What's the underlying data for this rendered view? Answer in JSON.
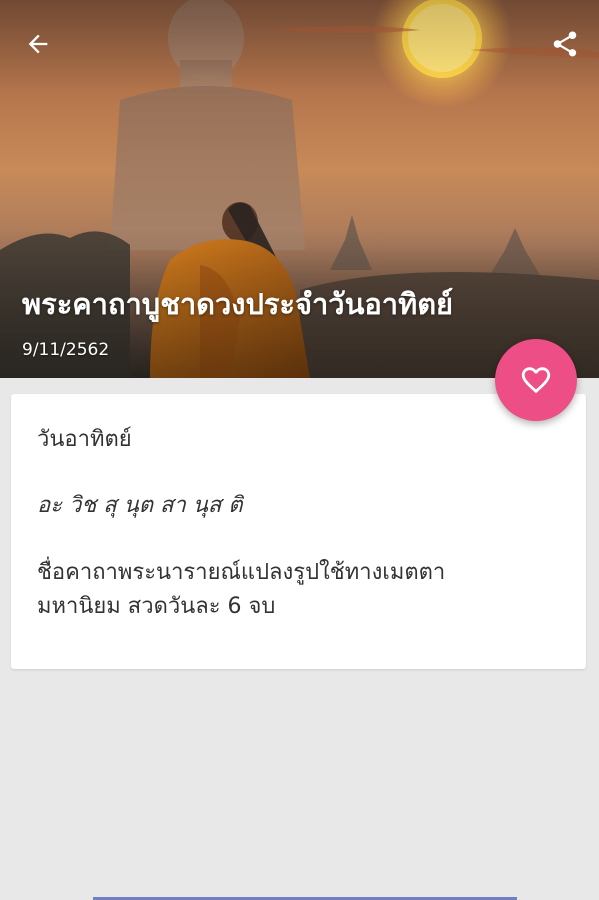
{
  "header": {
    "title": "พระคาถาบูชาดวงประจำวันอาทิตย์",
    "date": "9/11/2562",
    "back_icon": "arrow-left-icon",
    "share_icon": "share-icon"
  },
  "fab": {
    "icon": "heart-outline-icon",
    "color": "#ee4e86"
  },
  "card": {
    "day": "วันอาทิตย์",
    "mantra": "อะ วิช สุ นุต สา นุส ติ",
    "description_line1": "ชื่อคาถาพระนารายณ์แปลงรูปใช้ทางเมตตา",
    "description_line2": "มหานิยม สวดวันละ 6 จบ"
  },
  "colors": {
    "accent": "#ee4e86",
    "background": "#e8e8e8",
    "card": "#ffffff",
    "text": "#333333"
  }
}
